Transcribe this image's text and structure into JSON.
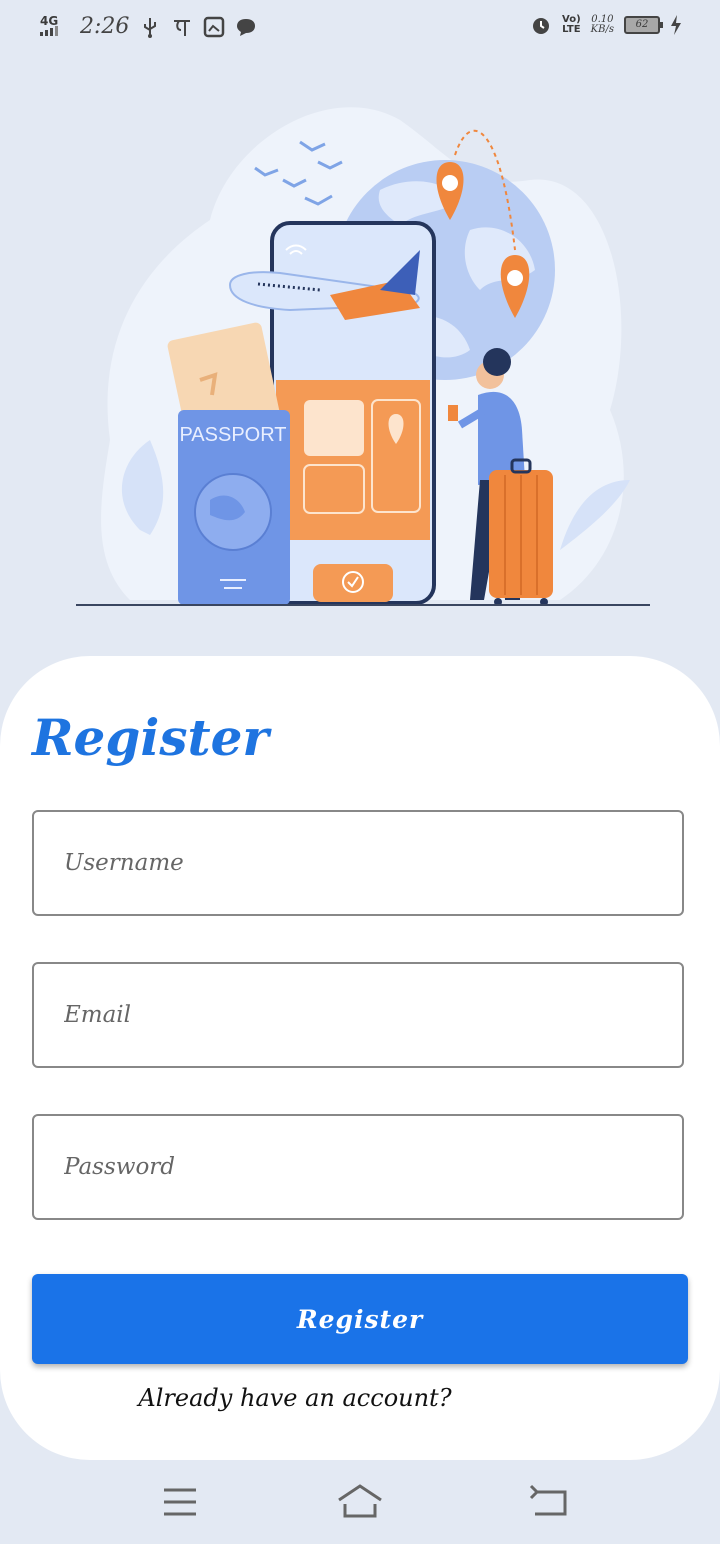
{
  "status_bar": {
    "network": "4G",
    "time": "2:26",
    "speed_value": "0.10",
    "speed_unit": "KB/s",
    "lte_top": "Vo)",
    "lte_bottom": "LTE",
    "battery": "62",
    "icons": [
      "signal-icon",
      "usb-icon",
      "notification-icon",
      "gallery-icon",
      "chat-icon",
      "alarm-icon",
      "charging-icon"
    ]
  },
  "illustration": {
    "passport_label": "PASSPORT"
  },
  "form": {
    "title": "Register",
    "username_placeholder": "Username",
    "email_placeholder": "Email",
    "password_placeholder": "Password",
    "submit_label": "Register",
    "login_prompt": "Already have an account?"
  },
  "nav_bar": {
    "icons": [
      "menu-icon",
      "home-icon",
      "back-icon"
    ]
  },
  "colors": {
    "accent": "#1a73e8",
    "title": "#1e74e0",
    "background": "#e3e9f3",
    "card": "#ffffff"
  }
}
